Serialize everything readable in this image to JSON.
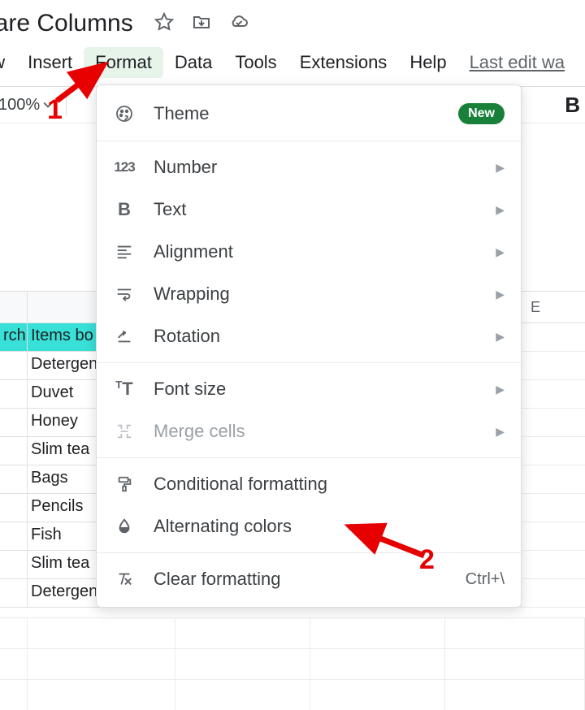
{
  "doc": {
    "title": "mpare Columns"
  },
  "menubar": {
    "items": [
      "ew",
      "Insert",
      "Format",
      "Data",
      "Tools",
      "Extensions",
      "Help"
    ],
    "active_index": 2,
    "last_edit": "Last edit wa"
  },
  "toolbar": {
    "zoom": "100%",
    "bold": "B"
  },
  "format_menu": {
    "theme": "Theme",
    "theme_badge": "New",
    "number": "Number",
    "text": "Text",
    "alignment": "Alignment",
    "wrapping": "Wrapping",
    "rotation": "Rotation",
    "font_size": "Font size",
    "merge": "Merge cells",
    "conditional": "Conditional formatting",
    "alternating": "Alternating colors",
    "clear": "Clear formatting",
    "clear_shortcut": "Ctrl+\\"
  },
  "sheet": {
    "col_e": "E",
    "header_cells": [
      "rch.",
      "Items bo"
    ],
    "rows": [
      [
        "",
        "Detergen"
      ],
      [
        "",
        "Duvet"
      ],
      [
        "",
        "Honey"
      ],
      [
        "",
        "Slim tea"
      ],
      [
        "",
        "Bags"
      ],
      [
        "",
        "Pencils"
      ],
      [
        "",
        "Fish"
      ],
      [
        "",
        "Slim tea"
      ],
      [
        "",
        "Detergen"
      ]
    ]
  },
  "annotations": {
    "n1": "1",
    "n2": "2"
  }
}
